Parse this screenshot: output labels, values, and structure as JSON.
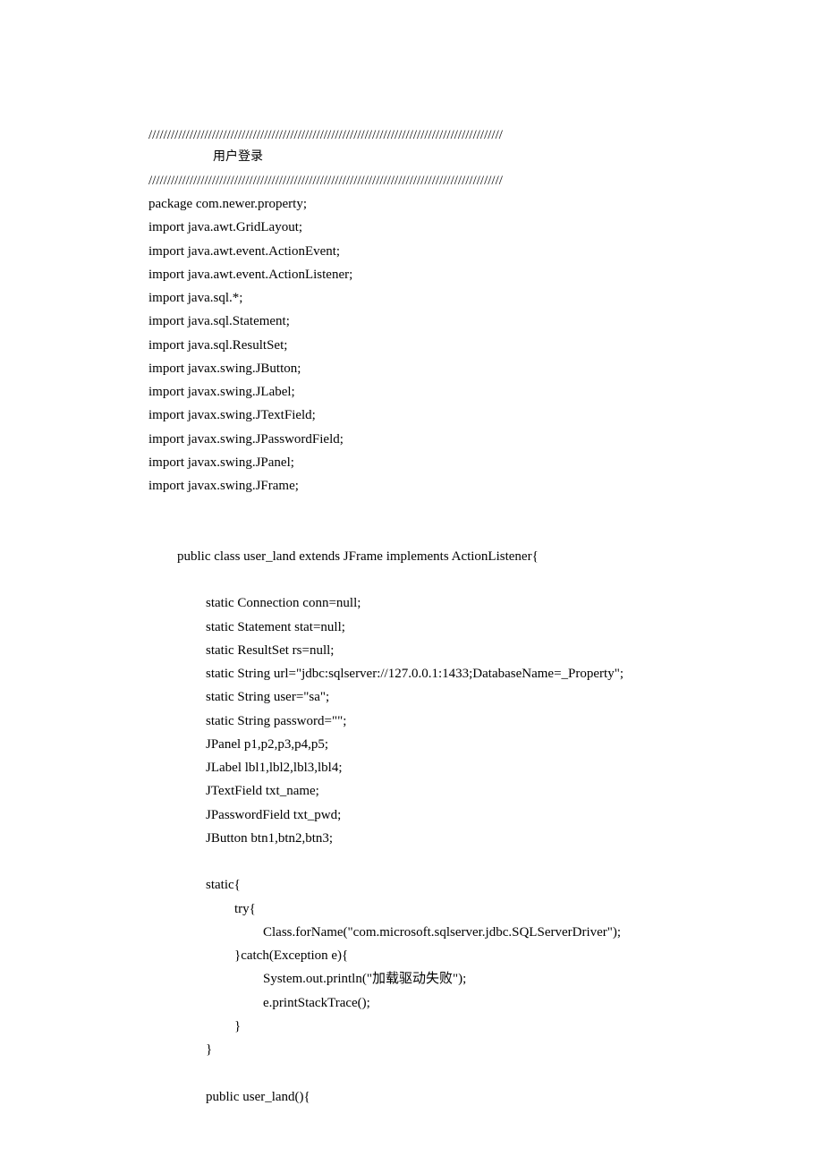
{
  "lines": [
    {
      "cls": "",
      "text": "///////////////////////////////////////////////////////////////////////////////////////////////"
    },
    {
      "cls": "title-pad cjk",
      "text": "用户登录"
    },
    {
      "cls": "",
      "text": "///////////////////////////////////////////////////////////////////////////////////////////////"
    },
    {
      "cls": "",
      "text": "package com.newer.property;"
    },
    {
      "cls": "",
      "text": "import java.awt.GridLayout;"
    },
    {
      "cls": "",
      "text": "import java.awt.event.ActionEvent;"
    },
    {
      "cls": "",
      "text": "import java.awt.event.ActionListener;"
    },
    {
      "cls": "",
      "text": "import java.sql.*;"
    },
    {
      "cls": "",
      "text": "import java.sql.Statement;"
    },
    {
      "cls": "",
      "text": "import java.sql.ResultSet;"
    },
    {
      "cls": "",
      "text": "import javax.swing.JButton;"
    },
    {
      "cls": "",
      "text": "import javax.swing.JLabel;"
    },
    {
      "cls": "",
      "text": "import javax.swing.JTextField;"
    },
    {
      "cls": "",
      "text": "import javax.swing.JPasswordField;"
    },
    {
      "cls": "",
      "text": "import javax.swing.JPanel;"
    },
    {
      "cls": "",
      "text": "import javax.swing.JFrame;"
    },
    {
      "cls": "",
      "text": " "
    },
    {
      "cls": "",
      "text": " "
    },
    {
      "cls": "indent1",
      "text": "public class user_land extends JFrame implements ActionListener{"
    },
    {
      "cls": "",
      "text": " "
    },
    {
      "cls": "indent2",
      "text": "static Connection conn=null;"
    },
    {
      "cls": "indent2",
      "text": "static Statement stat=null;"
    },
    {
      "cls": "indent2",
      "text": "static ResultSet rs=null;"
    },
    {
      "cls": "indent2",
      "text": "static String url=\"jdbc:sqlserver://127.0.0.1:1433;DatabaseName=_Property\";"
    },
    {
      "cls": "indent2",
      "text": "static String user=\"sa\";"
    },
    {
      "cls": "indent2",
      "text": "static String password=\"\";"
    },
    {
      "cls": "indent2",
      "text": "JPanel p1,p2,p3,p4,p5;"
    },
    {
      "cls": "indent2",
      "text": "JLabel lbl1,lbl2,lbl3,lbl4;"
    },
    {
      "cls": "indent2",
      "text": "JTextField txt_name;"
    },
    {
      "cls": "indent2",
      "text": "JPasswordField txt_pwd;"
    },
    {
      "cls": "indent2",
      "text": "JButton btn1,btn2,btn3;"
    },
    {
      "cls": "",
      "text": " "
    },
    {
      "cls": "indent2",
      "text": "static{"
    },
    {
      "cls": "indent3",
      "text": "try{"
    },
    {
      "cls": "indent4",
      "text": "Class.forName(\"com.microsoft.sqlserver.jdbc.SQLServerDriver\");"
    },
    {
      "cls": "indent3",
      "text": "}catch(Exception e){"
    },
    {
      "cls": "indent4",
      "text": "System.out.println(\"加载驱动失败\");"
    },
    {
      "cls": "indent4",
      "text": "e.printStackTrace();"
    },
    {
      "cls": "indent3",
      "text": "}"
    },
    {
      "cls": "indent2",
      "text": "}"
    },
    {
      "cls": "",
      "text": " "
    },
    {
      "cls": "indent2",
      "text": "public user_land(){"
    }
  ]
}
